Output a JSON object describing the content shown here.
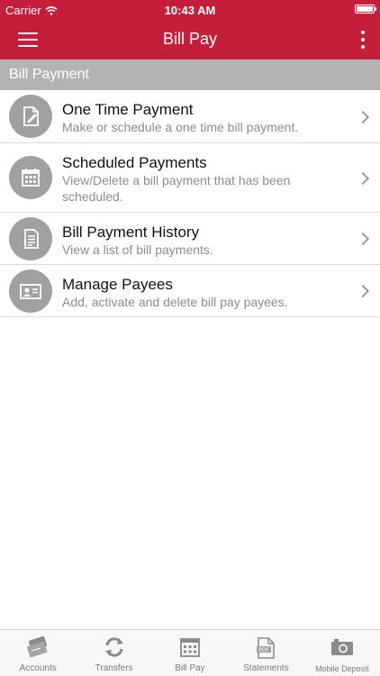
{
  "status_bar": {
    "carrier": "Carrier",
    "time": "10:43 AM"
  },
  "nav": {
    "title": "Bill Pay",
    "menu_icon": "hamburger-menu-icon",
    "more_icon": "vertical-dots-icon"
  },
  "section": {
    "title": "Bill Payment"
  },
  "items": [
    {
      "icon": "document-edit-icon",
      "title": "One Time Payment",
      "desc_lines": [
        "Make or schedule a one time bill payment."
      ]
    },
    {
      "icon": "calendar-icon",
      "title": "Scheduled Payments",
      "desc_lines": [
        "View/Delete a bill payment that has been",
        "scheduled."
      ]
    },
    {
      "icon": "document-list-icon",
      "title": "Bill Payment History",
      "desc_lines": [
        "View a list of bill payments."
      ]
    },
    {
      "icon": "id-card-icon",
      "title": "Manage Payees",
      "desc_lines": [
        "Add, activate and delete bill pay payees."
      ]
    }
  ],
  "tabs": [
    {
      "label": "Accounts",
      "icon": "cards-icon"
    },
    {
      "label": "Transfers",
      "icon": "refresh-arrows-icon"
    },
    {
      "label": "Bill Pay",
      "icon": "calendar-icon"
    },
    {
      "label": "Statements",
      "icon": "pdf-document-icon"
    },
    {
      "label": "Mobile Deposit",
      "icon": "camera-icon"
    }
  ],
  "colors": {
    "brand_red": "#c41e3a",
    "section_gray": "#b3b3b3",
    "icon_circle": "#a0a0a0"
  }
}
